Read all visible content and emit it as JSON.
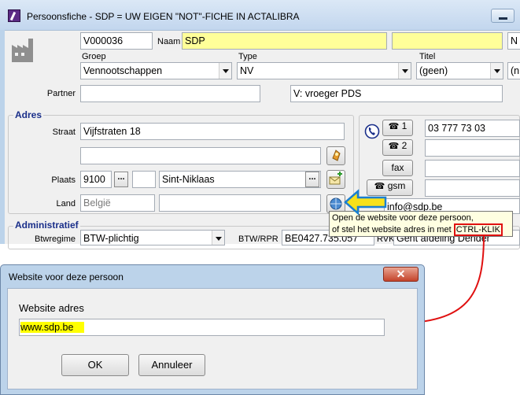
{
  "window": {
    "title": "Persoonsfiche - SDP  = UW EIGEN \"NOT\"-FICHE IN ACTALIBRA"
  },
  "header": {
    "id_value": "V000036",
    "naam_label": "Naam",
    "naam_value": "SDP",
    "naam2_value": "",
    "extra_value": "N",
    "groep_label": "Groep",
    "groep_value": "Vennootschappen",
    "type_label": "Type",
    "type_value": "NV",
    "titel_label": "Titel",
    "titel_value": "(geen)",
    "extra2_value": "(n",
    "partner_label": "Partner",
    "partner_value": "",
    "note_value": "V: vroeger PDS"
  },
  "adres": {
    "section_title": "Adres",
    "straat_label": "Straat",
    "straat_value": "Vijfstraten 18",
    "straat2_value": "",
    "plaats_label": "Plaats",
    "postcode_value": "9100",
    "plaats_extra_value": "",
    "gemeente_value": "Sint-Niklaas",
    "land_label": "Land",
    "land_value": "België",
    "land2_value": ""
  },
  "contact": {
    "phone1_label": "1",
    "phone1_value": "03 777 73 03",
    "phone2_label": "2",
    "phone2_value": "",
    "fax_label": "fax",
    "fax_value": "",
    "gsm_label": "gsm",
    "gsm_value": "",
    "email_value": "info@sdp.be"
  },
  "administratief": {
    "section_title": "Administratief",
    "btwregime_label": "Btwregime",
    "btwregime_value": "BTW-plichtig",
    "btw_label": "BTW/RPR",
    "btw_value": "BE0427.735.057",
    "rvk_label": "RVK",
    "rvk_value": "Gent afdeling Dender"
  },
  "tooltip": {
    "line1": "Open de website voor deze persoon,",
    "line2_prefix": "of stel het website adres in met ",
    "shortcut": "CTRL-KLIK"
  },
  "dialog": {
    "title": "Website voor deze persoon",
    "close_label": "✕",
    "field_label": "Website adres",
    "field_value": "www.sdp.be",
    "ok_label": "OK",
    "cancel_label": "Annuleer"
  },
  "colors": {
    "highlight_yellow": "#ffff99",
    "callout_arrow": "#e01010",
    "pointer_arrow": "#f7e11a"
  }
}
